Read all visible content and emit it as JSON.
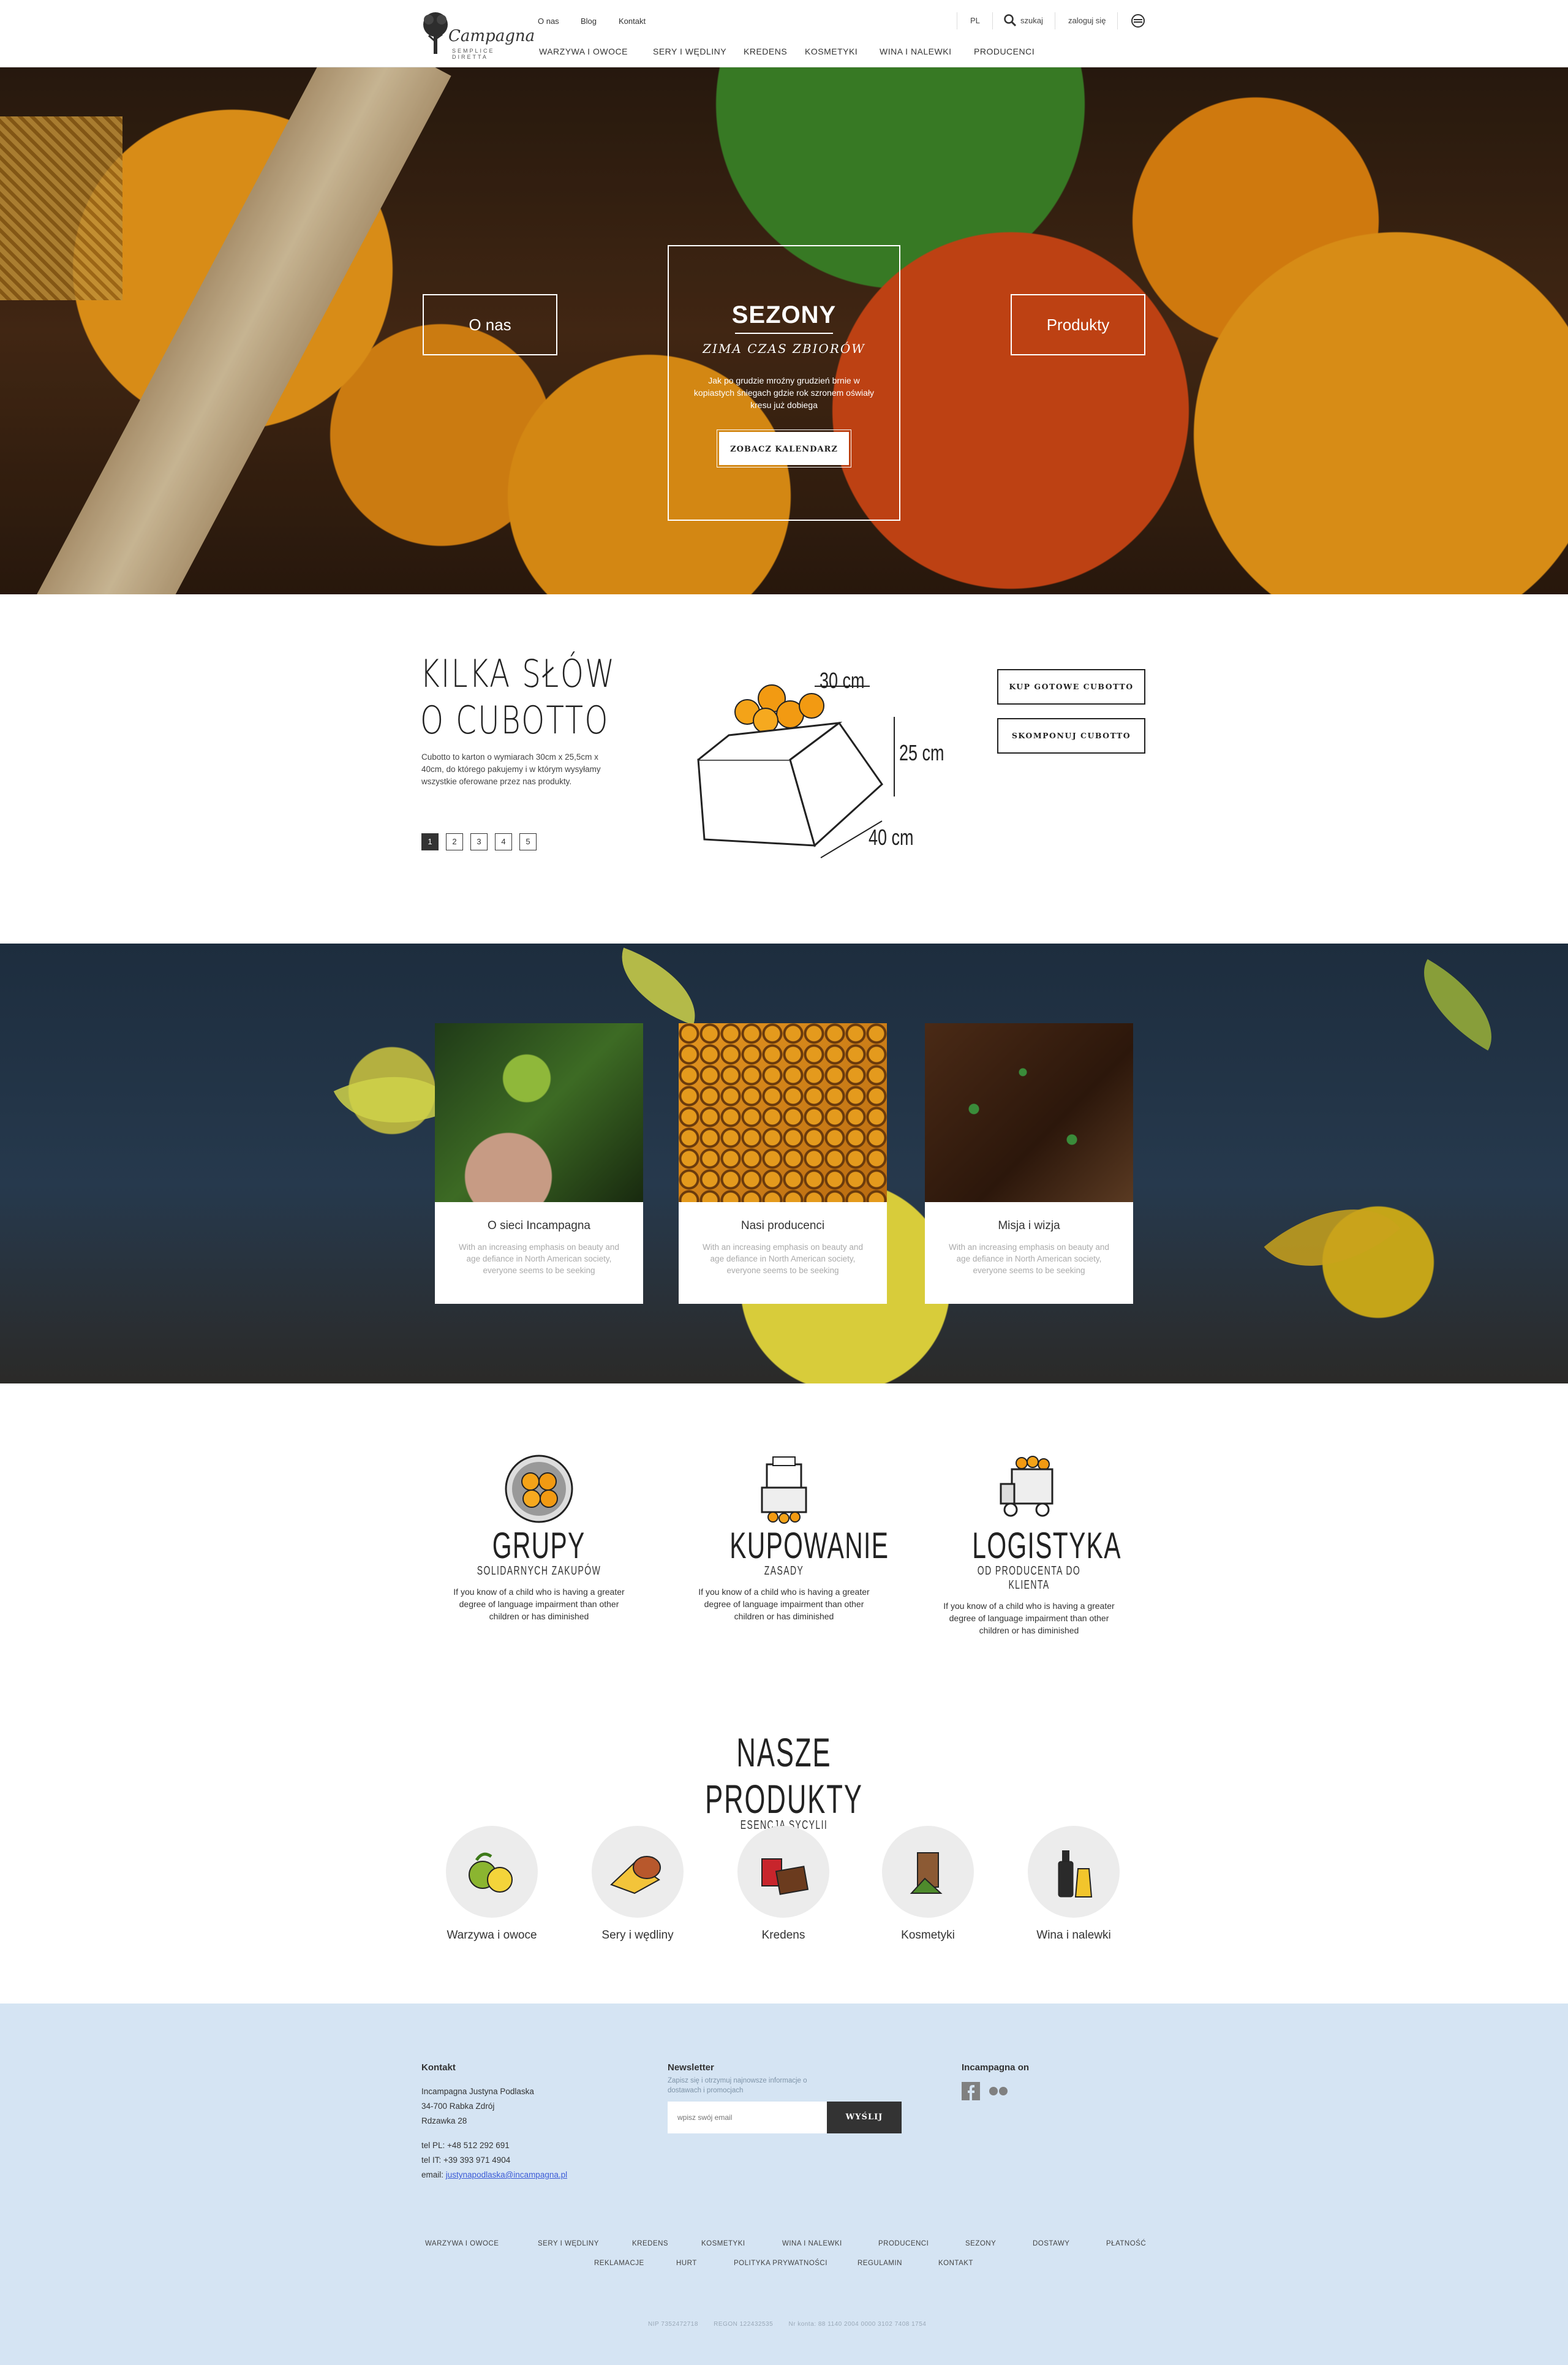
{
  "header": {
    "logo_text": "Campagna",
    "logo_sub": "SEMPLICE DIRETTA",
    "top_links": [
      "O nas",
      "Blog",
      "Kontakt"
    ],
    "main_nav": [
      "WARZYWA I OWOCE",
      "SERY I WĘDLINY",
      "KREDENS",
      "KOSMETYKI",
      "WINA I NALEWKI",
      "PRODUCENCI"
    ],
    "lang": "PL",
    "search_label": "szukaj",
    "login_label": "zaloguj się"
  },
  "hero": {
    "left_button": "O nas",
    "right_button": "Produkty",
    "title": "SEZONY",
    "subtitle": "ZIMA CZAS ZBIORÓW",
    "text": "Jak po grudzie mroźny grudzień brnie w kopiastych śniegach gdzie rok szronem oświały kresu już dobiega",
    "cta": "ZOBACZ KALENDARZ"
  },
  "cubotto": {
    "title_line1": "KILKA SŁÓW",
    "title_line2": "O CUBOTTO",
    "text": "Cubotto to karton o wymiarach 30cm x 25,5cm x 40cm, do którego pakujemy i w którym wysyłamy wszystkie oferowane przez nas produkty.",
    "pages": [
      "1",
      "2",
      "3",
      "4",
      "5"
    ],
    "dims": [
      "30 cm",
      "25 cm",
      "40 cm"
    ],
    "buy_button": "KUP GOTOWE CUBOTTO",
    "compose_button": "SKOMPONUJ CUBOTTO"
  },
  "features": [
    {
      "title": "O sieci Incampagna",
      "text": "With an increasing emphasis on beauty and age defiance in North American society, everyone seems to be seeking"
    },
    {
      "title": "Nasi producenci",
      "text": "With an increasing emphasis on beauty and age defiance in North American society, everyone seems to be seeking"
    },
    {
      "title": "Misja i wizja",
      "text": "With an increasing emphasis on beauty and age defiance in North American society, everyone seems to be seeking"
    }
  ],
  "info": [
    {
      "title": "GRUPY",
      "sub": "SOLIDARNYCH ZAKUPÓW",
      "text": "If you know of a child who is having a greater degree of language impairment than other children or has diminished"
    },
    {
      "title": "KUPOWANIE",
      "sub": "ZASADY",
      "text": "If you know of a child who is having a greater degree of language impairment than other children or has diminished"
    },
    {
      "title": "LOGISTYKA",
      "sub": "OD PRODUCENTA DO KLIENTA",
      "text": "If you know of a child who is having a greater degree of language impairment than other children or has diminished"
    }
  ],
  "products": {
    "title": "NASZE PRODUKTY",
    "subtitle": "ESENCJA SYCYLII",
    "items": [
      "Warzywa i owoce",
      "Sery i wędliny",
      "Kredens",
      "Kosmetyki",
      "Wina i nalewki"
    ]
  },
  "footer": {
    "contact_title": "Kontakt",
    "address": [
      "Incampagna Justyna Podlaska",
      "34-700 Rabka Zdrój",
      "Rdzawka 28"
    ],
    "phones": [
      "tel PL: +48 512 292 691",
      "tel IT: +39 393 971 4904"
    ],
    "email_label": "email:",
    "email": "justynapodlaska@incampagna.pl",
    "newsletter_title": "Newsletter",
    "newsletter_text": "Zapisz się i otrzymuj najnowsze informacje o dostawach i promocjach",
    "newsletter_placeholder": "wpisz swój email",
    "newsletter_button": "WYŚLIJ",
    "social_title": "Incampagna on",
    "links_row1": [
      "WARZYWA I OWOCE",
      "SERY I WĘDLINY",
      "KREDENS",
      "KOSMETYKI",
      "WINA I NALEWKI",
      "PRODUCENCI",
      "SEZONY",
      "DOSTAWY",
      "PŁATNOŚĆ"
    ],
    "links_row2": [
      "REKLAMACJE",
      "HURT",
      "POLITYKA PRYWATNOŚCI",
      "REGULAMIN",
      "KONTAKT"
    ],
    "legal": [
      "NIP 7352472718",
      "REGON 122432535",
      "Nr konta: 88 1140 2004 0000 3102 7408 1754"
    ]
  },
  "colors": {
    "footer_bg": "#d5e4f3",
    "dark_button": "#333333",
    "email_link": "#3b5bd6"
  }
}
